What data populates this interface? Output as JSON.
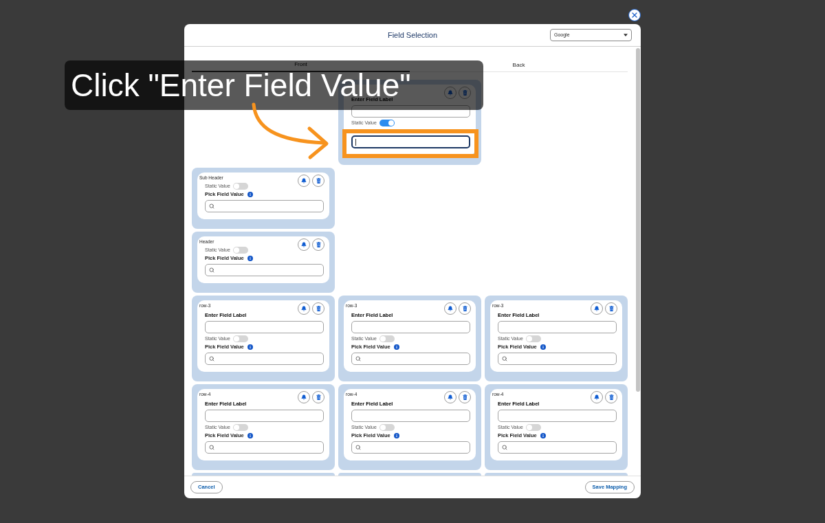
{
  "dialog": {
    "title": "Field Selection",
    "source_select": {
      "value": "Google"
    }
  },
  "tabs": [
    {
      "label": "Front",
      "selected": true
    },
    {
      "label": "Back",
      "selected": false
    }
  ],
  "grid": [
    {
      "cut_off": false,
      "cells": [
        {
          "kind": "empty"
        },
        {
          "kind": "field",
          "label_field": {
            "label": "Enter Field Label"
          },
          "static_value": {
            "label": "Static Value",
            "on": true
          },
          "value_field": {
            "focused": true
          }
        },
        {
          "kind": "empty"
        }
      ]
    },
    {
      "cut_off": false,
      "cells": [
        {
          "kind": "field",
          "title": "Sub Header",
          "static_value": {
            "label": "Static Value",
            "on": false
          },
          "pick_field": {
            "label": "Pick Field Value"
          }
        },
        {
          "kind": "empty"
        },
        {
          "kind": "empty"
        }
      ]
    },
    {
      "cut_off": false,
      "cells": [
        {
          "kind": "field",
          "title": "Header",
          "static_value": {
            "label": "Static Value",
            "on": false
          },
          "pick_field": {
            "label": "Pick Field Value"
          }
        },
        {
          "kind": "empty"
        },
        {
          "kind": "empty"
        }
      ]
    },
    {
      "cut_off": false,
      "cells": [
        {
          "kind": "field",
          "title": "row-3",
          "label_field": {
            "label": "Enter Field Label"
          },
          "static_value": {
            "label": "Static Value",
            "on": false
          },
          "pick_field": {
            "label": "Pick Field Value"
          }
        },
        {
          "kind": "field",
          "title": "row-3",
          "label_field": {
            "label": "Enter Field Label"
          },
          "static_value": {
            "label": "Static Value",
            "on": false
          },
          "pick_field": {
            "label": "Pick Field Value"
          }
        },
        {
          "kind": "field",
          "title": "row-3",
          "label_field": {
            "label": "Enter Field Label"
          },
          "static_value": {
            "label": "Static Value",
            "on": false
          },
          "pick_field": {
            "label": "Pick Field Value"
          }
        }
      ]
    },
    {
      "cut_off": false,
      "cells": [
        {
          "kind": "field",
          "title": "row-4",
          "label_field": {
            "label": "Enter Field Label"
          },
          "static_value": {
            "label": "Static Value",
            "on": false
          },
          "pick_field": {
            "label": "Pick Field Value"
          }
        },
        {
          "kind": "field",
          "title": "row-4",
          "label_field": {
            "label": "Enter Field Label"
          },
          "static_value": {
            "label": "Static Value",
            "on": false
          },
          "pick_field": {
            "label": "Pick Field Value"
          }
        },
        {
          "kind": "field",
          "title": "row-4",
          "label_field": {
            "label": "Enter Field Label"
          },
          "static_value": {
            "label": "Static Value",
            "on": false
          },
          "pick_field": {
            "label": "Pick Field Value"
          }
        }
      ]
    },
    {
      "cut_off": true,
      "cells": [
        {
          "kind": "field"
        },
        {
          "kind": "field"
        },
        {
          "kind": "field"
        }
      ]
    }
  ],
  "footer": {
    "buttons": [
      {
        "label": "Cancel"
      },
      {
        "label": "Save Mapping"
      }
    ]
  },
  "annotation": {
    "text": "Click \"Enter Field Value\""
  }
}
